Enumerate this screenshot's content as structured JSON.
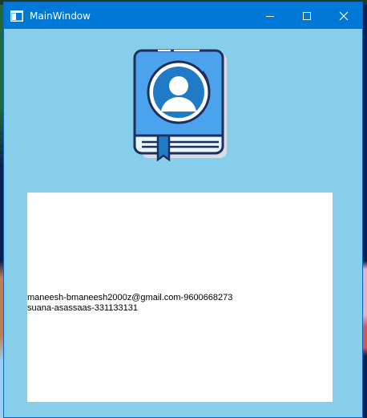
{
  "window": {
    "title": "MainWindow"
  },
  "titlebar": {
    "icons": [
      "window-app-icon",
      "minimize-icon",
      "maximize-icon",
      "close-icon"
    ]
  },
  "logo": {
    "icon": "address-book-user-icon"
  },
  "contacts": {
    "lines": [
      "maneesh-bmaneesh2000z@gmail.com-9600668273",
      "suana-asassaas-331133131"
    ]
  },
  "colors": {
    "window_bg": "#87ceeb",
    "titlebar": "#0078d7",
    "panel": "#ffffff"
  }
}
